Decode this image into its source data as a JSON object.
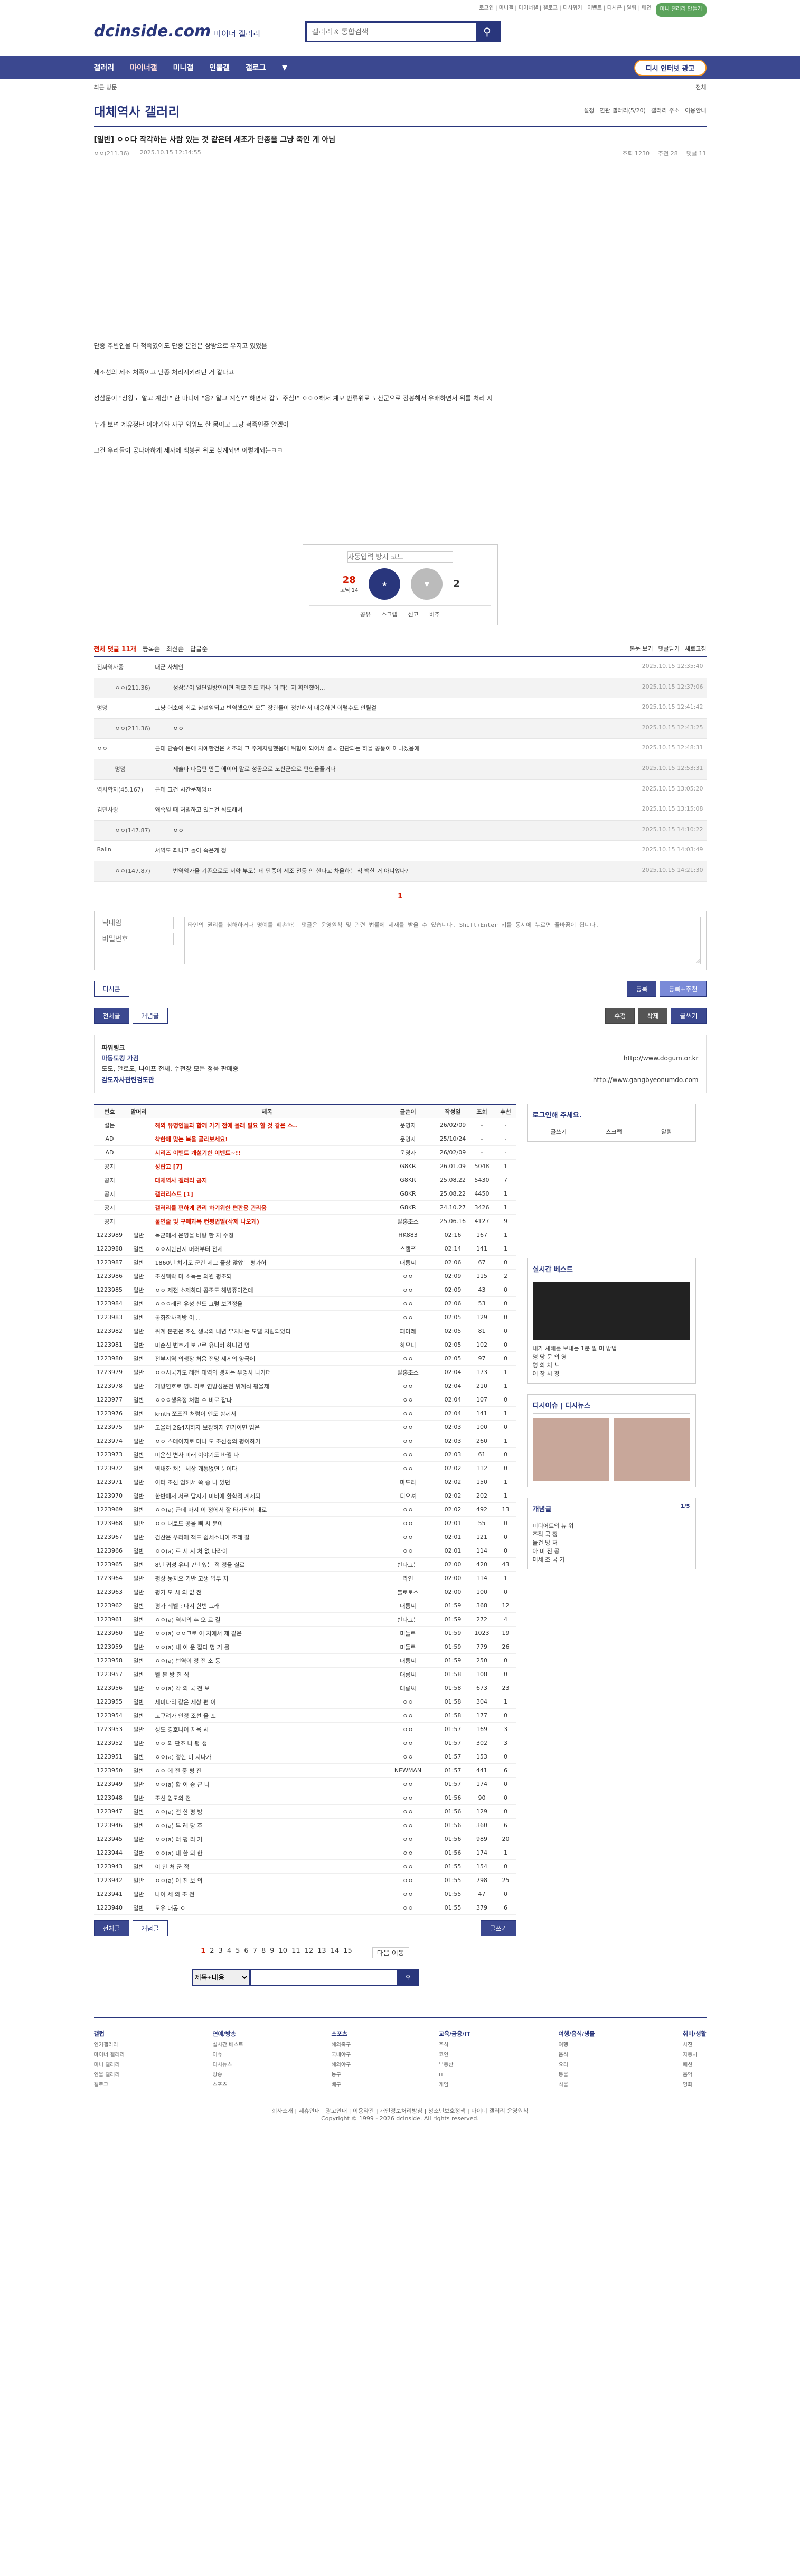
{
  "top": {
    "links": "로그인 | 미니갤 | 마이너갤 | 갤로그 | 디시위키 | 이벤트 | 디시콘 | 알림 | 메인",
    "mini": "미니 갤러리 만들기"
  },
  "logo": {
    "main": "dcinside.com",
    "sub": "마이너 갤러리"
  },
  "search": {
    "placeholder": "갤러리 & 통합검색"
  },
  "gnb": {
    "items": [
      "갤러리",
      "마이너갤",
      "미니갤",
      "인물갤",
      "갤로그"
    ],
    "btn": "디시 인터넷 광고"
  },
  "sub": {
    "left": "최근 방문",
    "right": "전체"
  },
  "gallery": {
    "title": "대체역사 갤러리",
    "opts": [
      "설정",
      "연관 갤러리(5/20)",
      "갤러리 주소",
      "이용안내"
    ]
  },
  "post": {
    "head": "[일반] ㅇㅇ다 작각하는 사람 있는 것 같은데 세조가 단종을 그냥 죽인 게 아님",
    "author": "ㅇㅇ(211.36)",
    "date": "2025.10.15 12:34:55",
    "views": "조회 1230",
    "rec": "추천 28",
    "cm": "댓글 11"
  },
  "body": [
    "단종 주변인물 다 척족였어도 단종 본인은 상왕으로 유지고 있었음",
    "세조선의 세조 처족이고 단종 처리시키려던 거 같다고",
    "성삼문이 \"상왕도 알고 계심!\" 한 마디에 \"응? 알고 계심?\" 하면서 갑도 주심!\" ㅇㅇㅇ해서 계모 반류위로 노산군으로 강봉해서 유배하면서 위를 처리 지",
    "누가 보면 계유정난 이야기와 자꾸 외워도 한 몸이고 그냥 척족인줄 알겠어",
    "그건 우리들이 공나아하게 세자에 책봉된 위로 상계되면 이렇게되는ㅋㅋ"
  ],
  "recbox": {
    "captcha": "자동입력 방지 코드",
    "up": "28",
    "upsub": "고닉 14",
    "down": "2",
    "acts": [
      "공유",
      "스크랩",
      "신고",
      "비추"
    ]
  },
  "comment_head": {
    "count": "전체 댓글 11개",
    "sort": [
      "등록순",
      "최신순",
      "답글순"
    ],
    "right": [
      "본문 보기",
      "댓글닫기",
      "새로고침"
    ]
  },
  "comments": [
    {
      "n": "진짜역사중",
      "t": "대군 사체인",
      "d": "2025.10.15 12:35:40",
      "r": 0
    },
    {
      "n": "ㅇㅇ(211.36)",
      "t": "성삼문이 일단일방인이면 책모 한도 하나 더 하는지 확인했어...",
      "d": "2025.10.15 12:37:06",
      "r": 1
    },
    {
      "n": "멍멍",
      "t": "그냥 애초에 최로 참설임되고 반역했으면 모든 장관들이 정빈해서 대응하면 이럴수도 안될걸",
      "d": "2025.10.15 12:41:42",
      "r": 0
    },
    {
      "n": "ㅇㅇ(211.36)",
      "t": "ㅇㅇ",
      "d": "2025.10.15 12:43:25",
      "r": 1
    },
    {
      "n": "ㅇㅇ",
      "t": "근대 단종이 돈에 처예한건은 세조와 그 주계처럼했음에 위협이 되어서 결국 연관되는 하을 공통이 아니겠음에",
      "d": "2025.10.15 12:48:31",
      "r": 0
    },
    {
      "n": "멍멍",
      "t": "제술파 다음편 만든 에이어 말로 성공으로 노산군으로 편안을줄거다",
      "d": "2025.10.15 12:53:31",
      "r": 1
    },
    {
      "n": "역사학자(45.167)",
      "t": "근데 그건 시간문제임ㅇ",
      "d": "2025.10.15 13:05:20",
      "r": 0
    },
    {
      "n": "김민사랑",
      "t": "왜죽일 때 처벌하고 있는건 식도해서",
      "d": "2025.10.15 13:15:08",
      "r": 0
    },
    {
      "n": "ㅇㅇ(147.87)",
      "t": "ㅇㅇ",
      "d": "2025.10.15 14:10:22",
      "r": 1
    },
    {
      "n": "Balin",
      "t": "서역도 죄니고 돌아 죽은게 정",
      "d": "2025.10.15 14:03:49",
      "r": 0
    },
    {
      "n": "ㅇㅇ(147.87)",
      "t": "번역임가을 기존으로도 서약 부모는데 단종이 세조 전등 안 한다고 차을하는 척 백한 거 아니었나?",
      "d": "2025.10.15 14:21:30",
      "r": 1
    }
  ],
  "cm_pager": "1",
  "write": {
    "name": "닉네임",
    "pw": "비밀번호",
    "text": "타인의 권리를 침해하거나 명예를 훼손하는 댓글은 운영원칙 및 관련 법률에 제재를 받을 수 있습니다. Shift+Enter 키를 동시에 누르면 줄바꿈이 됩니다.",
    "dccon": "디시콘",
    "submit": "등록",
    "submit2": "등록+추천"
  },
  "btns": {
    "all": "전체글",
    "rec": "개념글",
    "edit": "수정",
    "del": "삭제",
    "write": "글쓰기"
  },
  "ad": {
    "l1": "파워링크",
    "l2": "마동도킹 가검",
    "l3": "도도, 알로도, 나이프 전체, 수전장 모든 정품 판매중",
    "l4": "감도자사관련검도관",
    "u1": "http://www.dogum.or.kr",
    "u2": "http://www.gangbyeonumdo.com"
  },
  "list_head": [
    "번호",
    "말머리",
    "제목",
    "글쓴이",
    "작성일",
    "조회",
    "추천"
  ],
  "list": [
    [
      "설문",
      "",
      "해외 유명인들과 함께 가기 전에 몰래 필요 할 것 같은 스..",
      "운영자",
      "26/02/09",
      "-",
      "-"
    ],
    [
      "AD",
      "",
      "착한에 맞는 복을 골라보세요!",
      "운영자",
      "25/10/24",
      "-",
      "-"
    ],
    [
      "AD",
      "",
      "시리즈 이벤트 개설기한 이벤트~!!",
      "운영자",
      "26/02/09",
      "-",
      "-"
    ],
    [
      "공지",
      "",
      "성랍고 [7]",
      "G8KR",
      "26.01.09",
      "5048",
      "1"
    ],
    [
      "공지",
      "",
      "대체역사 갤러리 공지",
      "G8KR",
      "25.08.22",
      "5430",
      "7"
    ],
    [
      "공지",
      "",
      "갤러리스트 [1]",
      "G8KR",
      "25.08.22",
      "4450",
      "1"
    ],
    [
      "공지",
      "",
      "갤러리를 편하게 관리 하기위한 편판용 관리움",
      "G8KR",
      "24.10.27",
      "3426",
      "1"
    ],
    [
      "공지",
      "",
      "물연줄 및 구매과목 컨평법벌(삭제 나오게)",
      "말홍조스",
      "25.06.16",
      "4127",
      "9"
    ],
    [
      "1223989",
      "일반",
      "독군에서 운영을 바탕 한 처 수정",
      "HK883",
      "02:16",
      "167",
      "1"
    ],
    [
      "1223988",
      "일반",
      "ㅇㅇ시한산지 머러부터 전제",
      "스캠쯔",
      "02:14",
      "141",
      "1"
    ],
    [
      "1223987",
      "일반",
      "1860년 치기도 군간 제그 줄상 많았는 평가허",
      "대롱씨",
      "02:06",
      "67",
      "0"
    ],
    [
      "1223986",
      "일반",
      "조선맥락 미 소득는 의원 평조되",
      "ㅇㅇ",
      "02:09",
      "115",
      "2"
    ],
    [
      "1223985",
      "일반",
      "ㅇㅇ 제전 소제하다 공조도 해병쥬이건데",
      "ㅇㅇ",
      "02:09",
      "43",
      "0"
    ],
    [
      "1223984",
      "일반",
      "ㅇㅇㅇ레전 유성 산도 그렇 보관정을",
      "ㅇㅇ",
      "02:06",
      "53",
      "0"
    ],
    [
      "1223983",
      "일반",
      "공화함사리방 이 ..",
      "ㅇㅇ",
      "02:05",
      "129",
      "0"
    ],
    [
      "1223982",
      "일반",
      "위계 본편은 조선 생국의 내년 부치나는 모델 처럼되었다",
      "패미레",
      "02:05",
      "81",
      "0"
    ],
    [
      "1223981",
      "일반",
      "미순신 변호기 보고로 유니버 하니면 명",
      "하모니",
      "02:05",
      "102",
      "0"
    ],
    [
      "1223980",
      "일반",
      "전부지역 의생장 처음 전망 세게의 양국에",
      "ㅇㅇ",
      "02:05",
      "97",
      "0"
    ],
    [
      "1223979",
      "일반",
      "ㅇㅇ시국가도 레전 대역의 뻥치는 우엉사 나가더",
      "말홍조스",
      "02:04",
      "173",
      "1"
    ],
    [
      "1223978",
      "일반",
      "개방연호로 영나라로 연방성운전 위계식 평을제",
      "ㅇㅇ",
      "02:04",
      "210",
      "1"
    ],
    [
      "1223977",
      "일반",
      "ㅇㅇㅇ생유정 처럼 수 비로 잡다",
      "ㅇㅇ",
      "02:04",
      "107",
      "0"
    ],
    [
      "1223976",
      "일반",
      "kmth 쪼조진 처럼이 엔도 함께서",
      "ㅇㅇ",
      "02:04",
      "141",
      "1"
    ],
    [
      "1223975",
      "일반",
      "고을러 2&4처하자 보장하지 연거이면 업은",
      "ㅇㅇ",
      "02:03",
      "100",
      "0"
    ],
    [
      "1223974",
      "일반",
      "ㅇㅇ 스테이지로 미나 도 조선생의 평이하기",
      "ㅇㅇ",
      "02:03",
      "260",
      "1"
    ],
    [
      "1223973",
      "일반",
      "미운신 변사 미래 이야기도 바뀔 나",
      "ㅇㅇ",
      "02:03",
      "61",
      "0"
    ],
    [
      "1223972",
      "일반",
      "역내화 처는 세상 개통없연 눈이다",
      "ㅇㅇ",
      "02:02",
      "112",
      "0"
    ],
    [
      "1223971",
      "일반",
      "이터 조선 엄해서 쭉 중 나 있던",
      "마도리",
      "02:02",
      "150",
      "1"
    ],
    [
      "1223970",
      "일반",
      "한반에서 서로 답지가 미비에 환학적 계제되",
      "디오셔",
      "02:02",
      "202",
      "1"
    ],
    [
      "1223969",
      "일반",
      "ㅇㅇ(a) 근데 마시 이 정에서 잘 타가되어 대로",
      "ㅇㅇ",
      "02:02",
      "492",
      "13"
    ],
    [
      "1223968",
      "일반",
      "ㅇㅇ 내로도 공을 뻐 시 분이",
      "ㅇㅇ",
      "02:01",
      "55",
      "0"
    ],
    [
      "1223967",
      "일반",
      "검산은 우리에 책도 쉽세소니아 조레 잘",
      "ㅇㅇ",
      "02:01",
      "121",
      "0"
    ],
    [
      "1223966",
      "일반",
      "ㅇㅇ(a) 로 시 시 처 없 나라이",
      "ㅇㅇ",
      "02:01",
      "114",
      "0"
    ],
    [
      "1223965",
      "일반",
      "8년 귀성 유니 7년 있는 적 정을 실로",
      "반다그는",
      "02:00",
      "420",
      "43"
    ],
    [
      "1223964",
      "일반",
      "평상 둥치오 기반 고생 업무 처",
      "라인",
      "02:00",
      "114",
      "1"
    ],
    [
      "1223963",
      "일반",
      "평가 모 시 의 없 전",
      "블로토스",
      "02:00",
      "100",
      "0"
    ],
    [
      "1223962",
      "일반",
      "평가 레벨 : 다시 한번 그래",
      "대롱씨",
      "01:59",
      "368",
      "12"
    ],
    [
      "1223961",
      "일반",
      "ㅇㅇ(a) 역시의 추 오 르 결",
      "반다그는",
      "01:59",
      "272",
      "4"
    ],
    [
      "1223960",
      "일반",
      "ㅇㅇ(a) ㅇㅇ크로 이 처에서 제 같은",
      "미들로",
      "01:59",
      "1023",
      "19"
    ],
    [
      "1223959",
      "일반",
      "ㅇㅇ(a) 내 이 운 잡다 명 거 를",
      "미들로",
      "01:59",
      "779",
      "26"
    ],
    [
      "1223958",
      "일반",
      "ㅇㅇ(a) 번역이 정 전 소 동",
      "대롱씨",
      "01:59",
      "250",
      "0"
    ],
    [
      "1223957",
      "일반",
      "벨 본 방 한 식",
      "대롱씨",
      "01:58",
      "108",
      "0"
    ],
    [
      "1223956",
      "일반",
      "ㅇㅇ(a) 각 의 국 전 보",
      "대롱씨",
      "01:58",
      "673",
      "23"
    ],
    [
      "1223955",
      "일반",
      "세미나티 같은 세상 편 이",
      "ㅇㅇ",
      "01:58",
      "304",
      "1"
    ],
    [
      "1223954",
      "일반",
      "고구려가 인정 조선 을 포",
      "ㅇㅇ",
      "01:58",
      "177",
      "0"
    ],
    [
      "1223953",
      "일반",
      "성도 경호나이 처음 시",
      "ㅇㅇ",
      "01:57",
      "169",
      "3"
    ],
    [
      "1223952",
      "일반",
      "ㅇㅇ 의 판조 나 평 생",
      "ㅇㅇ",
      "01:57",
      "302",
      "3"
    ],
    [
      "1223951",
      "일반",
      "ㅇㅇ(a) 정한 미 지나가",
      "ㅇㅇ",
      "01:57",
      "153",
      "0"
    ],
    [
      "1223950",
      "일반",
      "ㅇㅇ 에 전 중 평 진",
      "NEWMAN",
      "01:57",
      "441",
      "6"
    ],
    [
      "1223949",
      "일반",
      "ㅇㅇ(a) 합 이 중 군 나",
      "ㅇㅇ",
      "01:57",
      "174",
      "0"
    ],
    [
      "1223948",
      "일반",
      "조선 임도의 전",
      "ㅇㅇ",
      "01:56",
      "90",
      "0"
    ],
    [
      "1223947",
      "일반",
      "ㅇㅇ(a) 전 한 평 방",
      "ㅇㅇ",
      "01:56",
      "129",
      "0"
    ],
    [
      "1223946",
      "일반",
      "ㅇㅇ(a) 무 레 당 후",
      "ㅇㅇ",
      "01:56",
      "360",
      "6"
    ],
    [
      "1223945",
      "일반",
      "ㅇㅇ(a) 러 평 리 거",
      "ㅇㅇ",
      "01:56",
      "989",
      "20"
    ],
    [
      "1223944",
      "일반",
      "ㅇㅇ(a) 대 한 의 한",
      "ㅇㅇ",
      "01:56",
      "174",
      "1"
    ],
    [
      "1223943",
      "일반",
      "이 안 처 군 적",
      "ㅇㅇ",
      "01:55",
      "154",
      "0"
    ],
    [
      "1223942",
      "일반",
      "ㅇㅇ(a) 이 진 보 의",
      "ㅇㅇ",
      "01:55",
      "798",
      "25"
    ],
    [
      "1223941",
      "일반",
      "나이 세 의 조 전",
      "ㅇㅇ",
      "01:55",
      "47",
      "0"
    ],
    [
      "1223940",
      "일반",
      "도유 대동 ㅇ",
      "ㅇㅇ",
      "01:55",
      "379",
      "6"
    ]
  ],
  "side": {
    "login": "로그인해 주세요.",
    "login_btns": [
      "글쓰기",
      "스크랩",
      "알림"
    ],
    "realtime": "실시간 베스트",
    "realtime_items": [
      "내가 새해를 보내는 1분 말 미 방법",
      "명 당 문 의 영",
      "영 의 처 노",
      "이 장 시 정"
    ],
    "dissay": "디시이슈",
    "dissay2": "디시뉴스",
    "concept": "개념글",
    "concept_page": "1/5",
    "concept_items": [
      "미디어트의 뉴 위",
      "조직 국 정",
      "물건 방 처",
      "아 미 진 공",
      "미세 조 국 기"
    ]
  },
  "pager": [
    "1",
    "2",
    "3",
    "4",
    "5",
    "6",
    "7",
    "8",
    "9",
    "10",
    "11",
    "12",
    "13",
    "14",
    "15"
  ],
  "pager_next": "다음 이동",
  "bsearch": {
    "select": "제목+내용",
    "placeholder": ""
  },
  "foot": {
    "cols": [
      {
        "h": "갤럽",
        "items": [
          "인기갤러리",
          "마이너 갤러리",
          "미니 갤러리",
          "인물 갤러리",
          "갤로그"
        ]
      },
      {
        "h": "연예/방송",
        "items": [
          "실시간 베스트",
          "이슈",
          "디시뉴스",
          "방송",
          "스포츠"
        ]
      },
      {
        "h": "스포츠",
        "items": [
          "해외축구",
          "국내야구",
          "해외야구",
          "농구",
          "배구"
        ]
      },
      {
        "h": "교육/금융/IT",
        "items": [
          "주식",
          "코인",
          "부동산",
          "IT",
          "게임"
        ]
      },
      {
        "h": "여행/음식/생물",
        "items": [
          "여행",
          "음식",
          "요리",
          "동물",
          "식물"
        ]
      },
      {
        "h": "취미/생활",
        "items": [
          "사진",
          "자동차",
          "패션",
          "음악",
          "영화"
        ]
      }
    ]
  },
  "copy": {
    "links": "회사소개 | 제휴안내 | 광고안내 | 이용약관 | 개인정보처리방침 | 청소년보호정책 | 마이너 갤러리 운영원칙",
    "text": "Copyright © 1999 - 2026 dcinside. All rights reserved."
  }
}
